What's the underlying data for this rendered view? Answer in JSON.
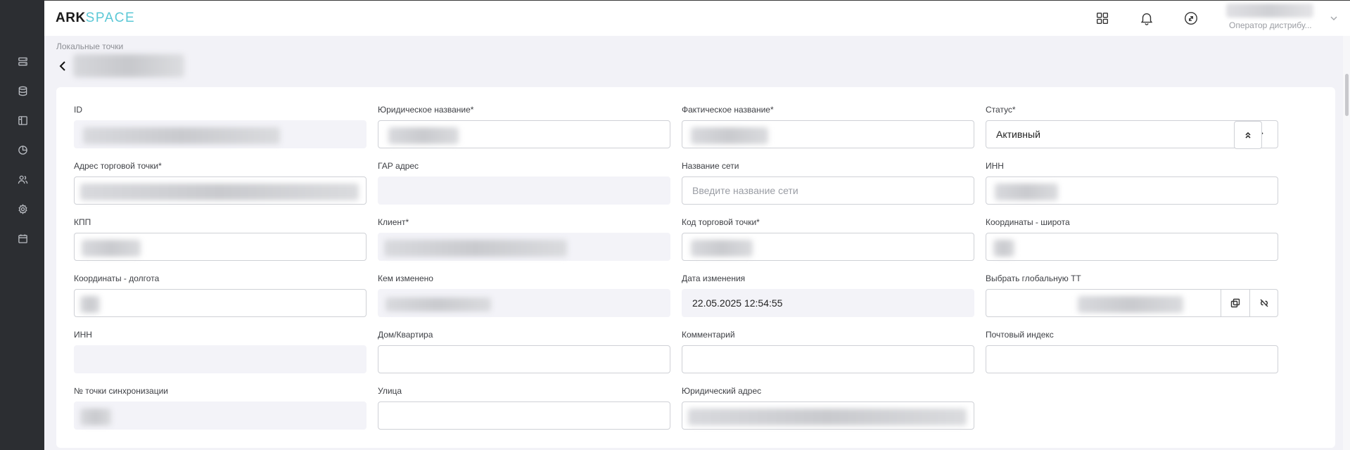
{
  "app": {
    "logo_ark": "ARK",
    "logo_space": "SPACE"
  },
  "header": {
    "icons": [
      "apps-grid-icon",
      "bell-icon",
      "sync-arrows-icon"
    ],
    "user_role": "Оператор дистрибу..."
  },
  "sidebar": {
    "icons": [
      "server-list-icon",
      "database-icon",
      "layout-panel-icon",
      "pie-chart-icon",
      "users-icon",
      "settings-gear-icon",
      "calendar-icon"
    ]
  },
  "breadcrumb": "Локальные точки",
  "form": {
    "id_label": "ID",
    "legal_name_label": "Юридическое название*",
    "actual_name_label": "Фактическое название*",
    "status_label": "Статус*",
    "status_value": "Активный",
    "address_label": "Адрес торговой точки*",
    "gar_label": "ГАР адрес",
    "network_label": "Название сети",
    "network_placeholder": "Введите название сети",
    "inn_label": "ИНН",
    "kpp_label": "КПП",
    "client_label": "Клиент*",
    "outlet_code_label": "Код торговой точки*",
    "lat_label": "Координаты - широта",
    "lon_label": "Координаты - долгота",
    "changed_by_label": "Кем изменено",
    "changed_date_label": "Дата изменения",
    "changed_date_value": "22.05.2025 12:54:55",
    "global_tt_label": "Выбрать глобальную ТТ",
    "inn2_label": "ИНН",
    "house_label": "Дом/Квартира",
    "comment_label": "Комментарий",
    "postcode_label": "Почтовый индекс",
    "sync_label": "№ точки синхронизации",
    "street_label": "Улица",
    "legal_address_label": "Юридический адрес"
  }
}
